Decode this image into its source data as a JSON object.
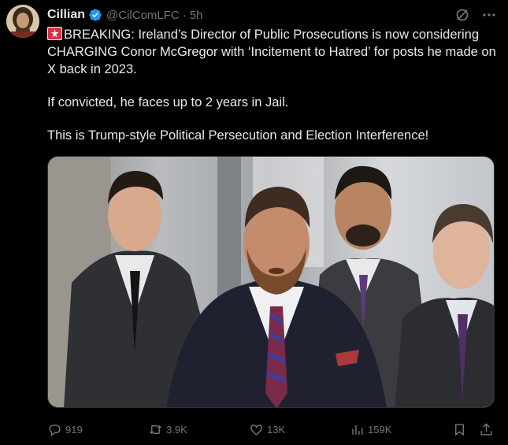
{
  "author": {
    "name": "Cillian",
    "handle": "@CilComLFC",
    "time": "5h",
    "separator": "·"
  },
  "tweet": {
    "emoji": "rotating-light-emoji",
    "paragraph1": "BREAKING: Ireland’s Director of Public Prosecutions is now considering CHARGING Conor McGregor with ‘Incitement to Hatred’ for posts he made on X back in 2023.",
    "paragraph2": "If convicted, he faces up to 2 years in Jail.",
    "paragraph3": "This is Trump-style Political Persecution and Election Interference!"
  },
  "metrics": {
    "replies": "919",
    "reposts": "3.9K",
    "likes": "13K",
    "views": "159K"
  },
  "icons": {
    "verified": "verified-badge-icon",
    "grok": "grok-icon",
    "more": "more-icon",
    "reply": "reply-icon",
    "repost": "repost-icon",
    "like": "heart-icon",
    "views": "views-icon",
    "bookmark": "bookmark-icon",
    "share": "share-icon"
  },
  "colors": {
    "background": "#000000",
    "text": "#e7e9ea",
    "muted": "#71767b",
    "verified": "#1d9bf0"
  }
}
